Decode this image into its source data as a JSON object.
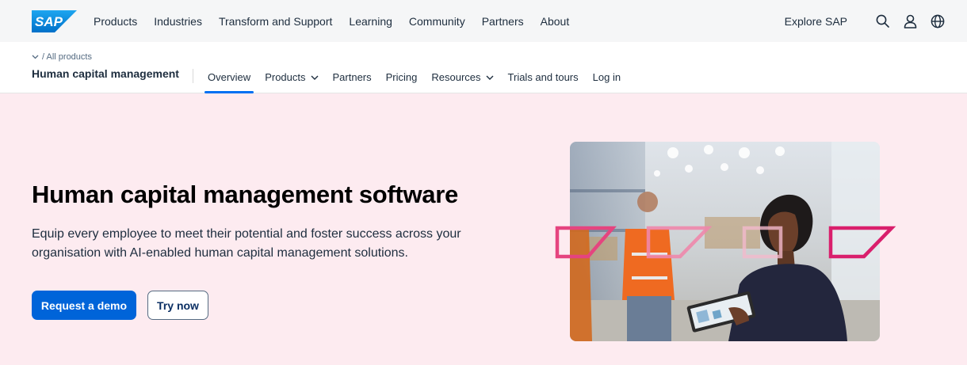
{
  "brand": {
    "logo_text": "SAP"
  },
  "topnav": {
    "items": [
      "Products",
      "Industries",
      "Transform and Support",
      "Learning",
      "Community",
      "Partners",
      "About"
    ],
    "explore_label": "Explore SAP",
    "icons": [
      "search-icon",
      "user-icon",
      "globe-icon"
    ]
  },
  "subnav": {
    "breadcrumb": "/ All products",
    "product_name": "Human capital management",
    "items": [
      {
        "label": "Overview",
        "active": true,
        "dropdown": false
      },
      {
        "label": "Products",
        "active": false,
        "dropdown": true
      },
      {
        "label": "Partners",
        "active": false,
        "dropdown": false
      },
      {
        "label": "Pricing",
        "active": false,
        "dropdown": false
      },
      {
        "label": "Resources",
        "active": false,
        "dropdown": true
      },
      {
        "label": "Trials and tours",
        "active": false,
        "dropdown": false
      },
      {
        "label": "Log in",
        "active": false,
        "dropdown": false
      }
    ]
  },
  "hero": {
    "title": "Human capital management software",
    "description": "Equip every employee to meet their potential and foster success across your organisation with AI-enabled human capital management solutions.",
    "primary_cta": "Request a demo",
    "secondary_cta": "Try now"
  },
  "colors": {
    "accent": "#0070f2",
    "primary_button": "#0064d9",
    "hero_bg": "#fdebf0",
    "topbar_bg": "#f5f6f7",
    "deco_pink": "#e5447f"
  }
}
